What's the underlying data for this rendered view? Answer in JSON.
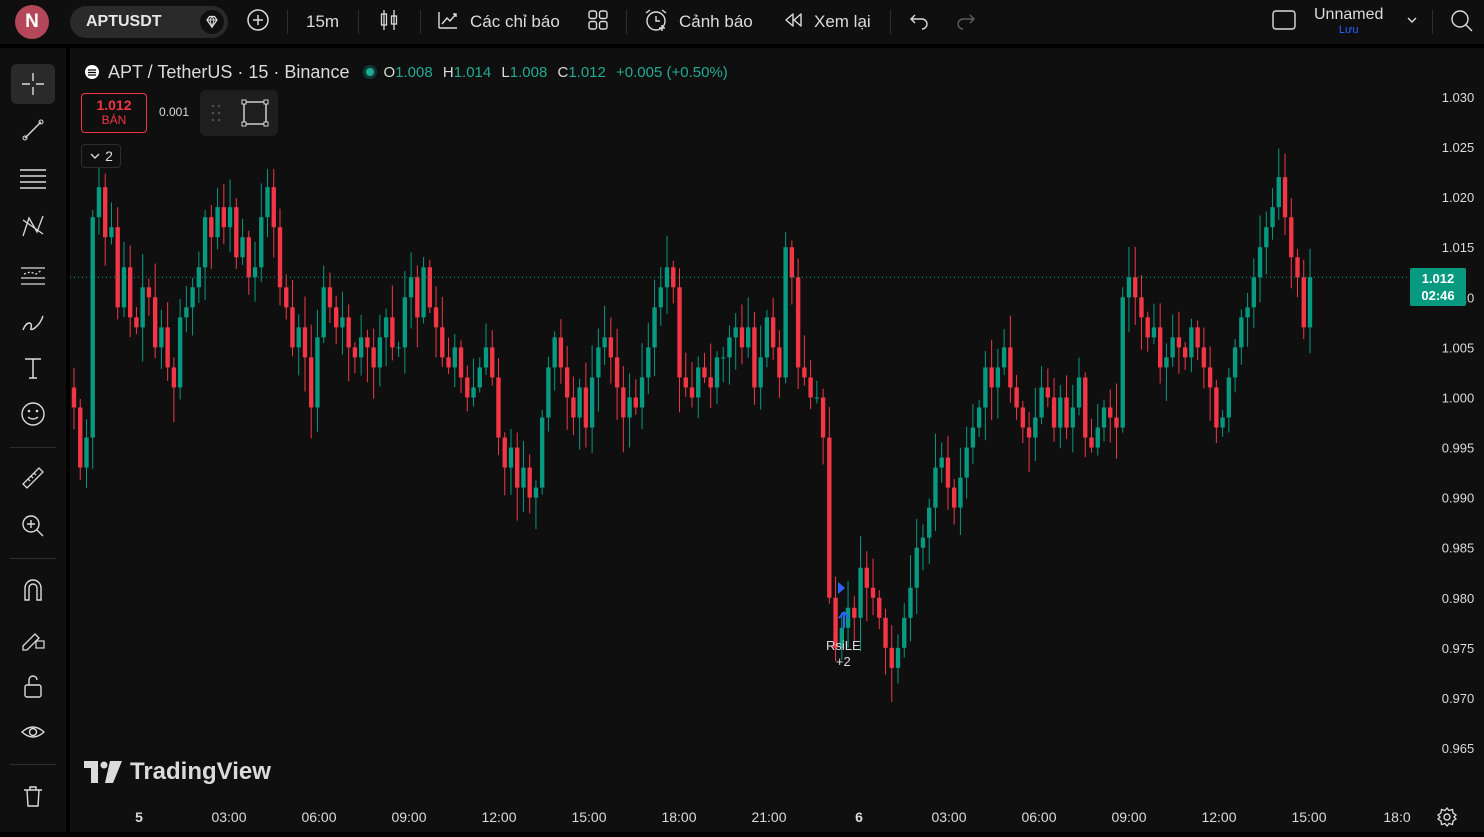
{
  "topbar": {
    "avatar_letter": "N",
    "symbol": "APTUSDT",
    "interval": "15m",
    "indicators_label": "Các chỉ báo",
    "alerts_label": "Cảnh báo",
    "replay_label": "Xem lại",
    "layout_name": "Unnamed",
    "save_label": "Lưu"
  },
  "legend": {
    "title": "APT / TetherUS · 15 · Binance",
    "open_key": "O",
    "open": "1.008",
    "high_key": "H",
    "high": "1.014",
    "low_key": "L",
    "low": "1.008",
    "close_key": "C",
    "close": "1.012",
    "change": "+0.005 (+0.50%)"
  },
  "trade": {
    "sell_price": "1.012",
    "sell_label": "BÁN",
    "lot": "0.001",
    "collapsed_count": "2"
  },
  "price_tag": {
    "price": "1.012",
    "countdown": "02:46"
  },
  "strategy_marker": {
    "name": "RsiLE",
    "count": "+2"
  },
  "brand": "TradingView",
  "colors": {
    "up": "#089981",
    "down": "#f23645",
    "bg": "#0f0f0f",
    "accent": "#2962ff"
  },
  "chart_data": {
    "type": "candlestick",
    "title": "",
    "xlabel": "",
    "ylabel": "",
    "x_ticks": [
      "5",
      "03:00",
      "06:00",
      "09:00",
      "12:00",
      "15:00",
      "18:00",
      "21:00",
      "6",
      "03:00",
      "06:00",
      "09:00",
      "12:00",
      "15:00",
      "18:0"
    ],
    "y_ticks": [
      "1.030",
      "1.025",
      "1.020",
      "1.015",
      "1.010",
      "1.005",
      "1.000",
      "0.995",
      "0.990",
      "0.985",
      "0.980",
      "0.975",
      "0.970",
      "0.965"
    ],
    "ylim": [
      0.962,
      1.032
    ],
    "last_price": 1.012,
    "close_series": [
      0.999,
      0.993,
      0.996,
      1.018,
      1.021,
      1.016,
      1.017,
      1.009,
      1.013,
      1.008,
      1.007,
      1.011,
      1.01,
      1.005,
      1.007,
      1.003,
      1.001,
      1.008,
      1.009,
      1.011,
      1.013,
      1.018,
      1.016,
      1.019,
      1.017,
      1.019,
      1.014,
      1.016,
      1.012,
      1.013,
      1.018,
      1.021,
      1.017,
      1.011,
      1.009,
      1.005,
      1.007,
      1.004,
      0.999,
      1.006,
      1.011,
      1.009,
      1.007,
      1.008,
      1.005,
      1.004,
      1.006,
      1.005,
      1.003,
      1.006,
      1.008,
      1.005,
      1.005,
      1.01,
      1.012,
      1.008,
      1.013,
      1.009,
      1.007,
      1.004,
      1.003,
      1.005,
      1.002,
      1.0,
      1.001,
      1.003,
      1.005,
      1.002,
      0.996,
      0.993,
      0.995,
      0.991,
      0.993,
      0.99,
      0.991,
      0.998,
      1.003,
      1.006,
      1.003,
      1.0,
      0.998,
      1.001,
      0.997,
      1.002,
      1.005,
      1.006,
      1.004,
      1.001,
      0.998,
      1.0,
      0.999,
      1.002,
      1.005,
      1.009,
      1.011,
      1.013,
      1.011,
      1.002,
      1.001,
      1.0,
      1.003,
      1.002,
      1.001,
      1.004,
      1.004,
      1.006,
      1.007,
      1.005,
      1.007,
      1.001,
      1.004,
      1.008,
      1.005,
      1.002,
      1.015,
      1.012,
      1.003,
      1.002,
      1.0,
      1.0,
      0.996,
      0.98,
      0.975,
      0.977,
      0.979,
      0.978,
      0.983,
      0.981,
      0.98,
      0.978,
      0.975,
      0.973,
      0.975,
      0.978,
      0.981,
      0.985,
      0.986,
      0.989,
      0.993,
      0.994,
      0.991,
      0.989,
      0.992,
      0.995,
      0.997,
      0.999,
      1.003,
      1.001,
      1.003,
      1.005,
      1.001,
      0.999,
      0.997,
      0.996,
      0.998,
      1.001,
      1.0,
      0.997,
      1.0,
      0.997,
      0.999,
      1.002,
      0.996,
      0.995,
      0.997,
      0.999,
      0.998,
      0.997,
      1.01,
      1.012,
      1.01,
      1.008,
      1.006,
      1.007,
      1.003,
      1.004,
      1.006,
      1.005,
      1.004,
      1.007,
      1.005,
      1.003,
      1.001,
      0.997,
      0.998,
      1.002,
      1.005,
      1.008,
      1.009,
      1.012,
      1.015,
      1.017,
      1.019,
      1.022,
      1.018,
      1.014,
      1.012,
      1.007,
      1.012
    ]
  }
}
